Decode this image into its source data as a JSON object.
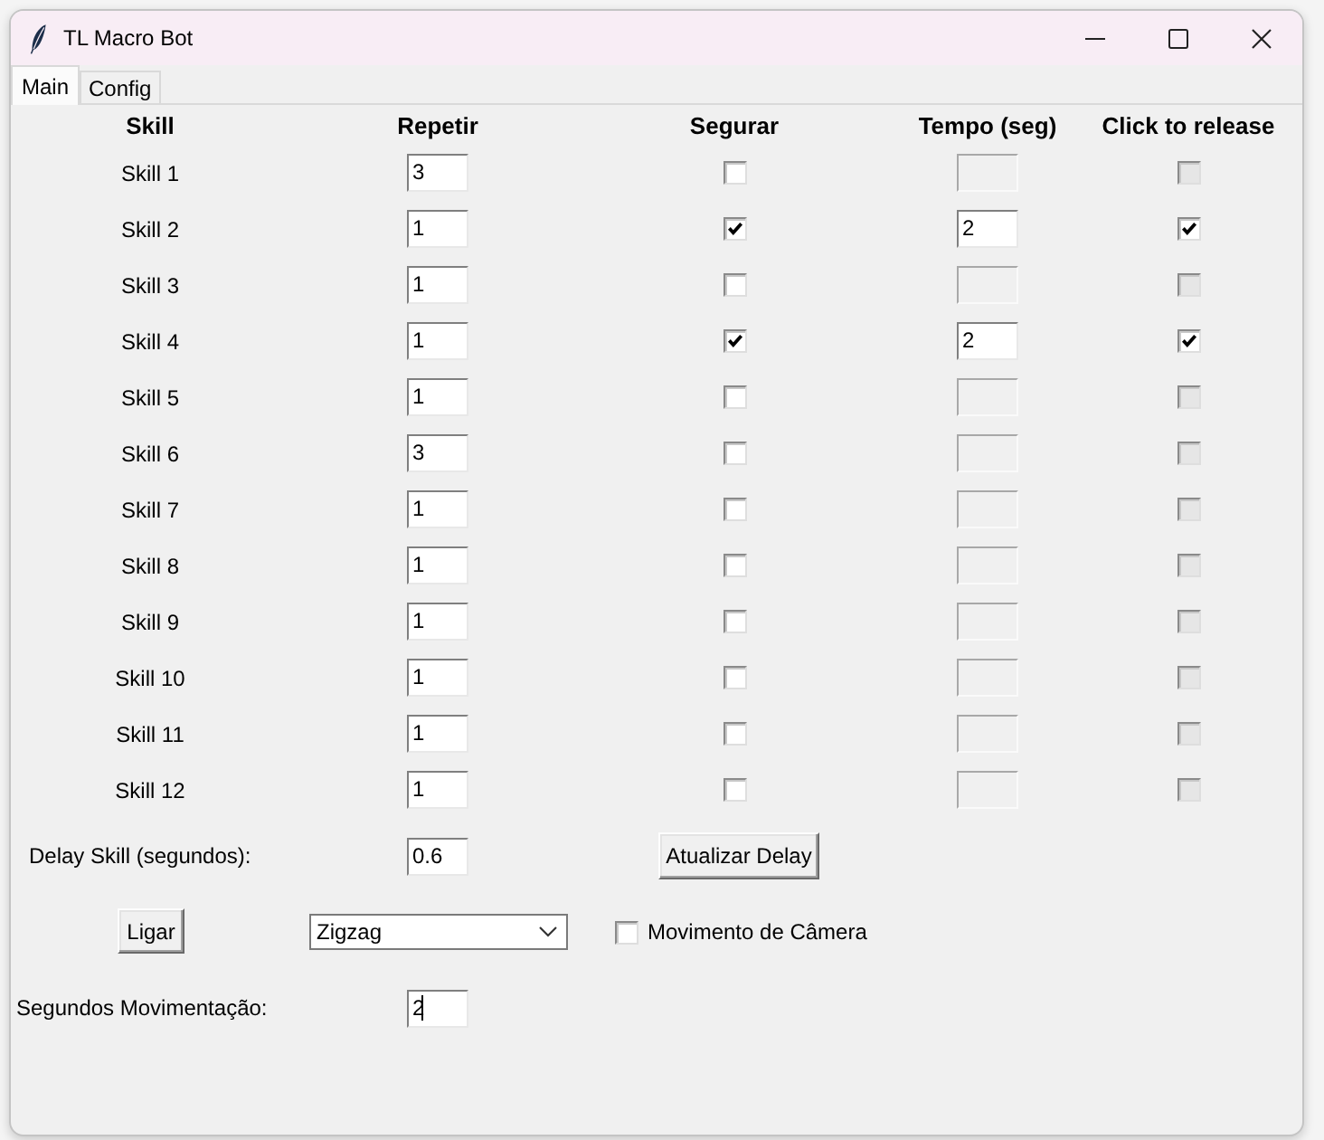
{
  "window": {
    "title": "TL Macro Bot"
  },
  "tabs": [
    {
      "label": "Main",
      "selected": true
    },
    {
      "label": "Config",
      "selected": false
    }
  ],
  "table": {
    "columns": [
      "Skill",
      "Repetir",
      "Segurar",
      "Tempo (seg)",
      "Click to release"
    ],
    "rows": [
      {
        "skill": "Skill 1",
        "repeat": "3",
        "hold": false,
        "time": {
          "disabled": true
        },
        "release": {
          "checked": false,
          "disabled": true
        }
      },
      {
        "skill": "Skill 2",
        "repeat": "1",
        "hold": true,
        "time": {
          "value": "2",
          "disabled": false
        },
        "release": {
          "checked": true,
          "disabled": false
        }
      },
      {
        "skill": "Skill 3",
        "repeat": "1",
        "hold": false,
        "time": {
          "disabled": true
        },
        "release": {
          "checked": false,
          "disabled": true
        }
      },
      {
        "skill": "Skill 4",
        "repeat": "1",
        "hold": true,
        "time": {
          "value": "2",
          "disabled": false
        },
        "release": {
          "checked": true,
          "disabled": false
        }
      },
      {
        "skill": "Skill 5",
        "repeat": "1",
        "hold": false,
        "time": {
          "disabled": true
        },
        "release": {
          "checked": false,
          "disabled": true
        }
      },
      {
        "skill": "Skill 6",
        "repeat": "3",
        "hold": false,
        "time": {
          "disabled": true
        },
        "release": {
          "checked": false,
          "disabled": true
        }
      },
      {
        "skill": "Skill 7",
        "repeat": "1",
        "hold": false,
        "time": {
          "disabled": true
        },
        "release": {
          "checked": false,
          "disabled": true
        }
      },
      {
        "skill": "Skill 8",
        "repeat": "1",
        "hold": false,
        "time": {
          "disabled": true
        },
        "release": {
          "checked": false,
          "disabled": true
        }
      },
      {
        "skill": "Skill 9",
        "repeat": "1",
        "hold": false,
        "time": {
          "disabled": true
        },
        "release": {
          "checked": false,
          "disabled": true
        }
      },
      {
        "skill": "Skill 10",
        "repeat": "1",
        "hold": false,
        "time": {
          "disabled": true
        },
        "release": {
          "checked": false,
          "disabled": true
        }
      },
      {
        "skill": "Skill 11",
        "repeat": "1",
        "hold": false,
        "time": {
          "disabled": true
        },
        "release": {
          "checked": false,
          "disabled": true
        }
      },
      {
        "skill": "Skill 12",
        "repeat": "1",
        "hold": false,
        "time": {
          "disabled": true
        },
        "release": {
          "checked": false,
          "disabled": true
        }
      }
    ]
  },
  "delay": {
    "label": "Delay Skill (segundos):",
    "value": "0.6",
    "button": "Atualizar Delay"
  },
  "controls": {
    "start_button": "Ligar",
    "mode": {
      "value": "Zigzag"
    },
    "camera": {
      "label": "Movimento de Câmera",
      "checked": false
    }
  },
  "movement": {
    "label": "Segundos Movimentação:",
    "value": "2",
    "focused": true
  }
}
